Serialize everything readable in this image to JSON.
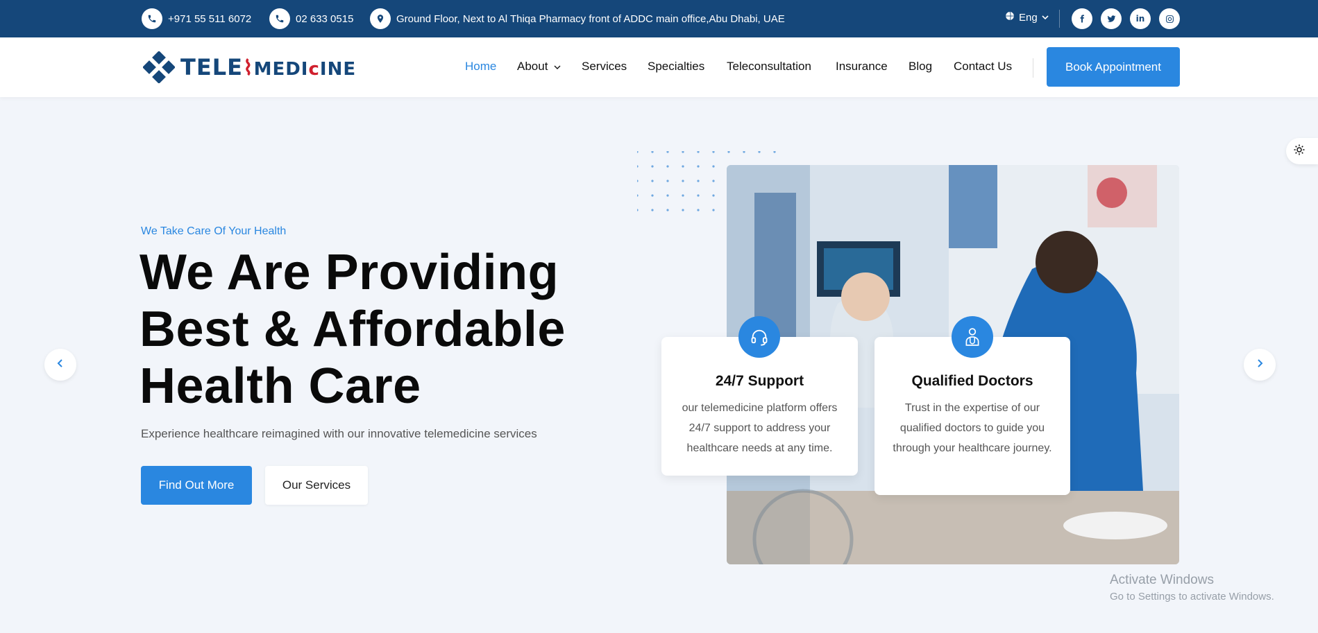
{
  "topbar": {
    "phone1": "+971 55 511 6072",
    "phone2": "02 633 0515",
    "address": "Ground Floor, Next to Al Thiqa Pharmacy front of ADDC main office,Abu Dhabi, UAE",
    "language": "Eng",
    "social_icons": [
      "facebook-icon",
      "twitter-icon",
      "linkedin-icon",
      "instagram-icon"
    ]
  },
  "header": {
    "logo_text_a": "TELE",
    "logo_text_b": "MEDI",
    "logo_text_c": "c",
    "logo_text_d": "INE",
    "nav": [
      {
        "label": "Home",
        "active": true
      },
      {
        "label": "About",
        "dropdown": true
      },
      {
        "label": "Services"
      },
      {
        "label": "Specialties"
      },
      {
        "label": "Teleconsultation"
      },
      {
        "label": "Insurance"
      },
      {
        "label": "Blog"
      },
      {
        "label": "Contact Us"
      }
    ],
    "cta": "Book Appointment"
  },
  "hero": {
    "subtitle": "We Take Care Of Your Health",
    "title": "We Are Providing Best & Affordable Health Care",
    "description": "Experience healthcare reimagined with our innovative telemedicine services",
    "primary_button": "Find Out More",
    "secondary_button": "Our Services"
  },
  "features": [
    {
      "icon": "headset-icon",
      "title": "24/7 Support",
      "text": "our telemedicine platform offers 24/7 support to address your healthcare needs at any time."
    },
    {
      "icon": "doctor-icon",
      "title": "Qualified Doctors",
      "text": "Trust in the expertise of our qualified doctors to guide you through your healthcare journey."
    }
  ],
  "overlay": {
    "line1": "Activate Windows",
    "line2": "Go to Settings to activate Windows."
  },
  "colors": {
    "primary": "#2a87e0",
    "topbar": "#15477a",
    "logo_red": "#d0202e",
    "background": "#f2f5fa"
  }
}
